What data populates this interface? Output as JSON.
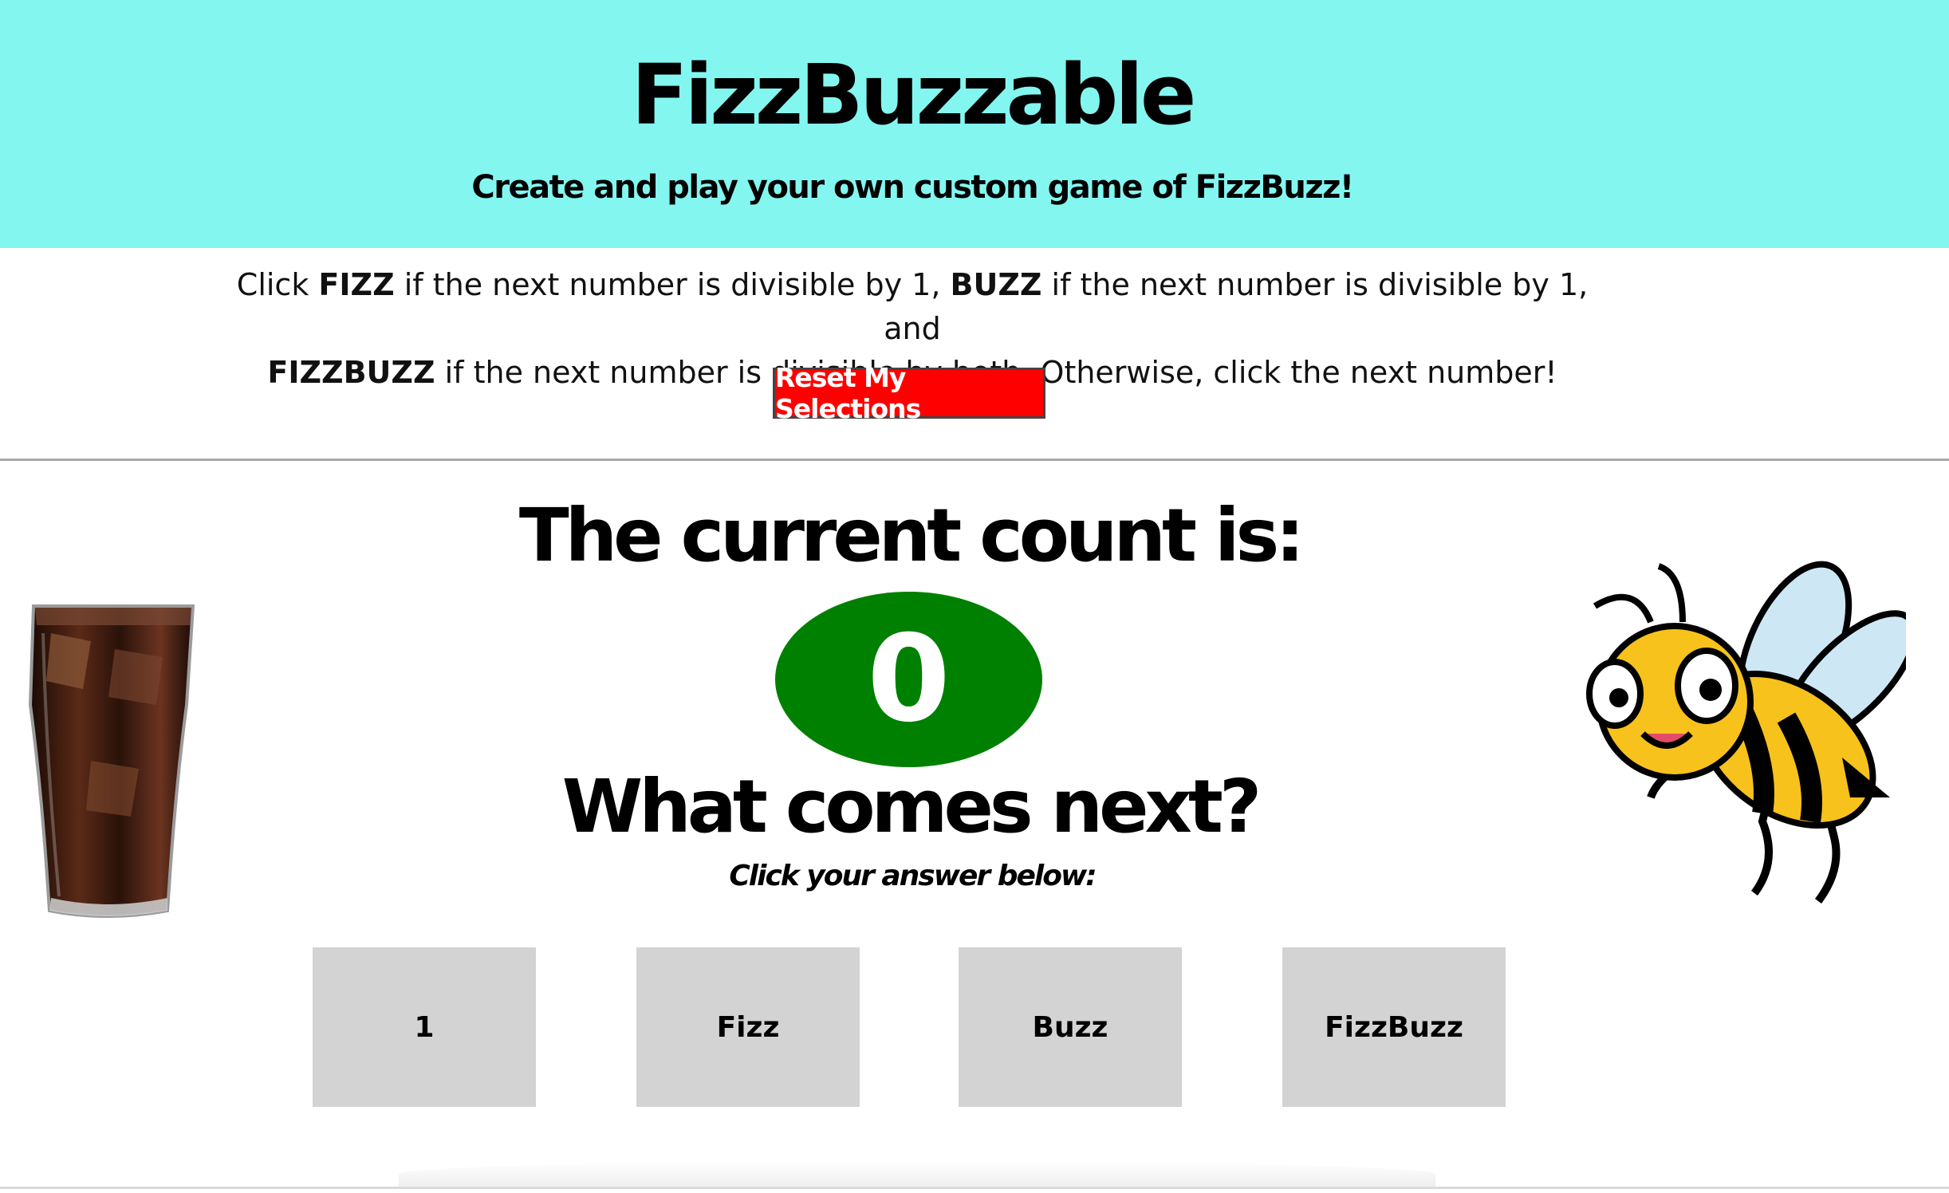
{
  "header": {
    "title": "FizzBuzzable",
    "subtitle": "Create and play your own custom game of FizzBuzz!",
    "background_color": "#83f6f0"
  },
  "instructions": {
    "part1": "Click ",
    "fizz_word": "FIZZ",
    "part2": " if the next number is divisible by 1, ",
    "buzz_word": "BUZZ",
    "part3": " if the next number is divisible by 1, and ",
    "fizzbuzz_word": "FIZZBUZZ",
    "part4": " if the next number is divisible by both. Otherwise, click the next number!"
  },
  "reset": {
    "label": "Reset My Selections",
    "color": "#ff0000"
  },
  "game": {
    "count_heading": "The current count is:",
    "current_count": "0",
    "count_color": "#008000",
    "next_heading": "What comes next?",
    "click_hint": "Click your answer below:"
  },
  "answers": [
    {
      "label": "1"
    },
    {
      "label": "Fizz"
    },
    {
      "label": "Buzz"
    },
    {
      "label": "FizzBuzz"
    }
  ],
  "images": {
    "left": "soda-glass-image",
    "right": "bee-image"
  }
}
